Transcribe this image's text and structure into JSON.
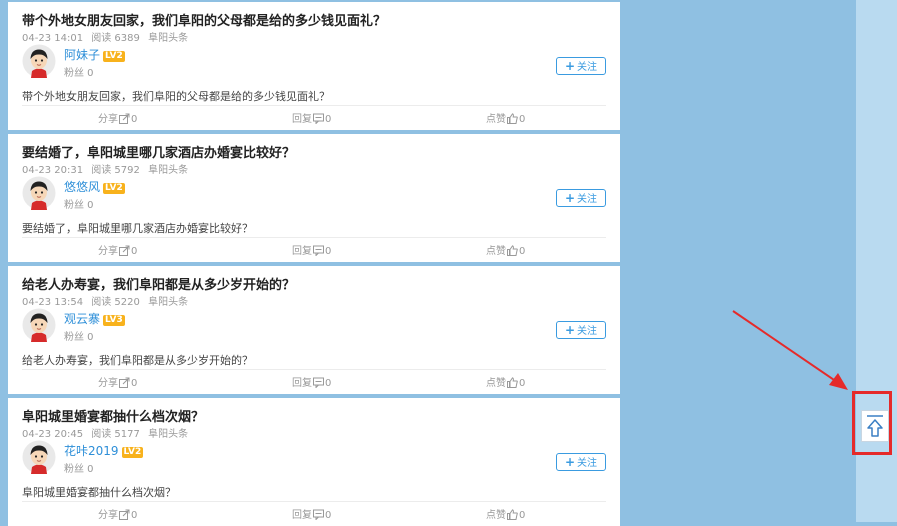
{
  "posts": [
    {
      "title": "带个外地女朋友回家，我们阜阳的父母都是给的多少钱见面礼？",
      "date": "04-23 14:01",
      "reads": "阅读 6389",
      "source": "阜阳头条",
      "username": "阿妹子",
      "level": "LV2",
      "fans": "粉丝 0",
      "follow": "关注",
      "excerpt": "带个外地女朋友回家，我们阜阳的父母都是给的多少钱见面礼？",
      "share": "分享",
      "share_count": "0",
      "reply": "回复",
      "reply_count": "0",
      "like": "点赞",
      "like_count": "0"
    },
    {
      "title": "要结婚了，阜阳城里哪几家酒店办婚宴比较好？",
      "date": "04-23 20:31",
      "reads": "阅读 5792",
      "source": "阜阳头条",
      "username": "悠悠风",
      "level": "LV2",
      "fans": "粉丝 0",
      "follow": "关注",
      "excerpt": "要结婚了，阜阳城里哪几家酒店办婚宴比较好？",
      "share": "分享",
      "share_count": "0",
      "reply": "回复",
      "reply_count": "0",
      "like": "点赞",
      "like_count": "0"
    },
    {
      "title": "给老人办寿宴，我们阜阳都是从多少岁开始的？",
      "date": "04-23 13:54",
      "reads": "阅读 5220",
      "source": "阜阳头条",
      "username": "观云寨",
      "level": "LV3",
      "fans": "粉丝 0",
      "follow": "关注",
      "excerpt": "给老人办寿宴，我们阜阳都是从多少岁开始的？",
      "share": "分享",
      "share_count": "0",
      "reply": "回复",
      "reply_count": "0",
      "like": "点赞",
      "like_count": "0"
    },
    {
      "title": "阜阳城里婚宴都抽什么档次烟？",
      "date": "04-23 20:45",
      "reads": "阅读 5177",
      "source": "阜阳头条",
      "username": "花咔2019",
      "level": "LV2",
      "fans": "粉丝 0",
      "follow": "关注",
      "excerpt": "阜阳城里婚宴都抽什么档次烟？",
      "share": "分享",
      "share_count": "0",
      "reply": "回复",
      "reply_count": "0",
      "like": "点赞",
      "like_count": "0"
    }
  ],
  "colors": {
    "page_background": "#8fc0e2",
    "link_blue": "#2e8fd8",
    "level_badge": "#f8b21c",
    "annotation_red": "#e52a2a"
  },
  "icons": {
    "share": "share-icon",
    "reply": "comment-icon",
    "like": "thumbs-up-icon",
    "back_to_top": "arrow-up-icon"
  }
}
